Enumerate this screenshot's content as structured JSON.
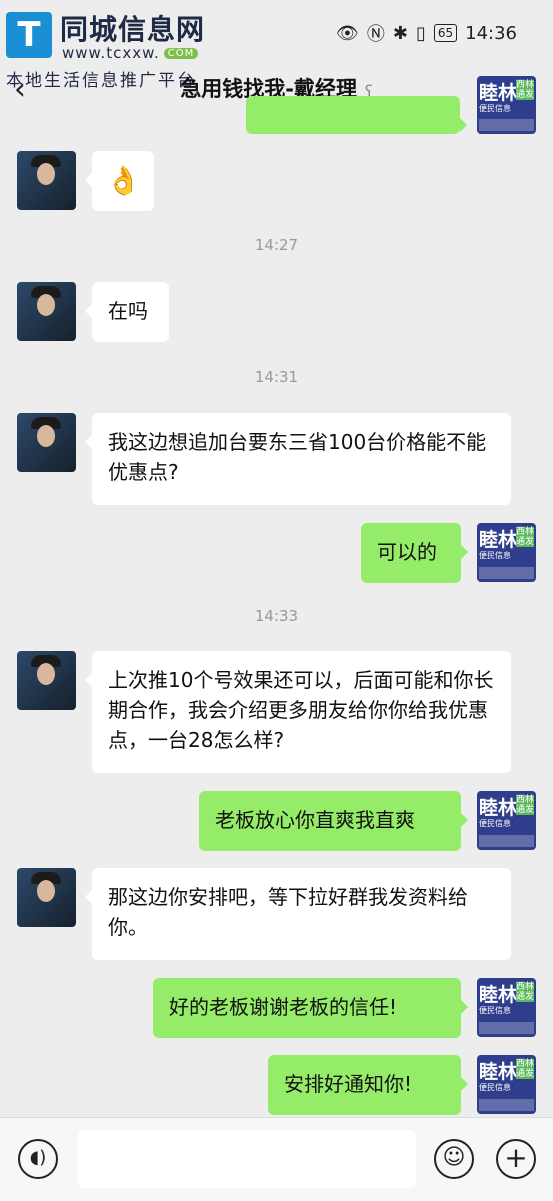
{
  "watermark": {
    "logo": "T",
    "title": "同城信息网",
    "url": "www.tcxxw.",
    "url_badge": "COM",
    "slogan": "本地生活信息推广平台"
  },
  "status_bar": {
    "battery": "65",
    "time": "14:36"
  },
  "header": {
    "title": "急用钱找我-戴经理",
    "back_icon": "chevron-left-icon",
    "more_icon": "more-dots-icon",
    "ear_icon": "ear-icon"
  },
  "contact_avatar_badge": {
    "big_text": "睦林",
    "tag_text": "西林通发",
    "sub_text": "便民信息"
  },
  "messages": [
    {
      "side": "right",
      "text": ""
    },
    {
      "side": "left",
      "text": "👌"
    },
    {
      "time": "14:27"
    },
    {
      "side": "left",
      "text": "在吗"
    },
    {
      "time": "14:31"
    },
    {
      "side": "left",
      "text": "我这边想追加台要东三省100台价格能不能优惠点?"
    },
    {
      "side": "right",
      "text": "可以的"
    },
    {
      "time": "14:33"
    },
    {
      "side": "left",
      "text": "上次推10个号效果还可以，后面可能和你长期合作，我会介绍更多朋友给你你给我优惠点，一台28怎么样?"
    },
    {
      "side": "right",
      "text": "老板放心你直爽我直爽"
    },
    {
      "side": "left",
      "text": "那这边你安排吧，等下拉好群我发资料给你。"
    },
    {
      "side": "right",
      "text": "好的老板谢谢老板的信任!"
    },
    {
      "side": "right",
      "text": "安排好通知你!"
    }
  ],
  "input_bar": {
    "voice_icon": "voice-icon",
    "emoji_icon": "emoji-icon",
    "plus_icon": "plus-icon",
    "input_value": ""
  }
}
